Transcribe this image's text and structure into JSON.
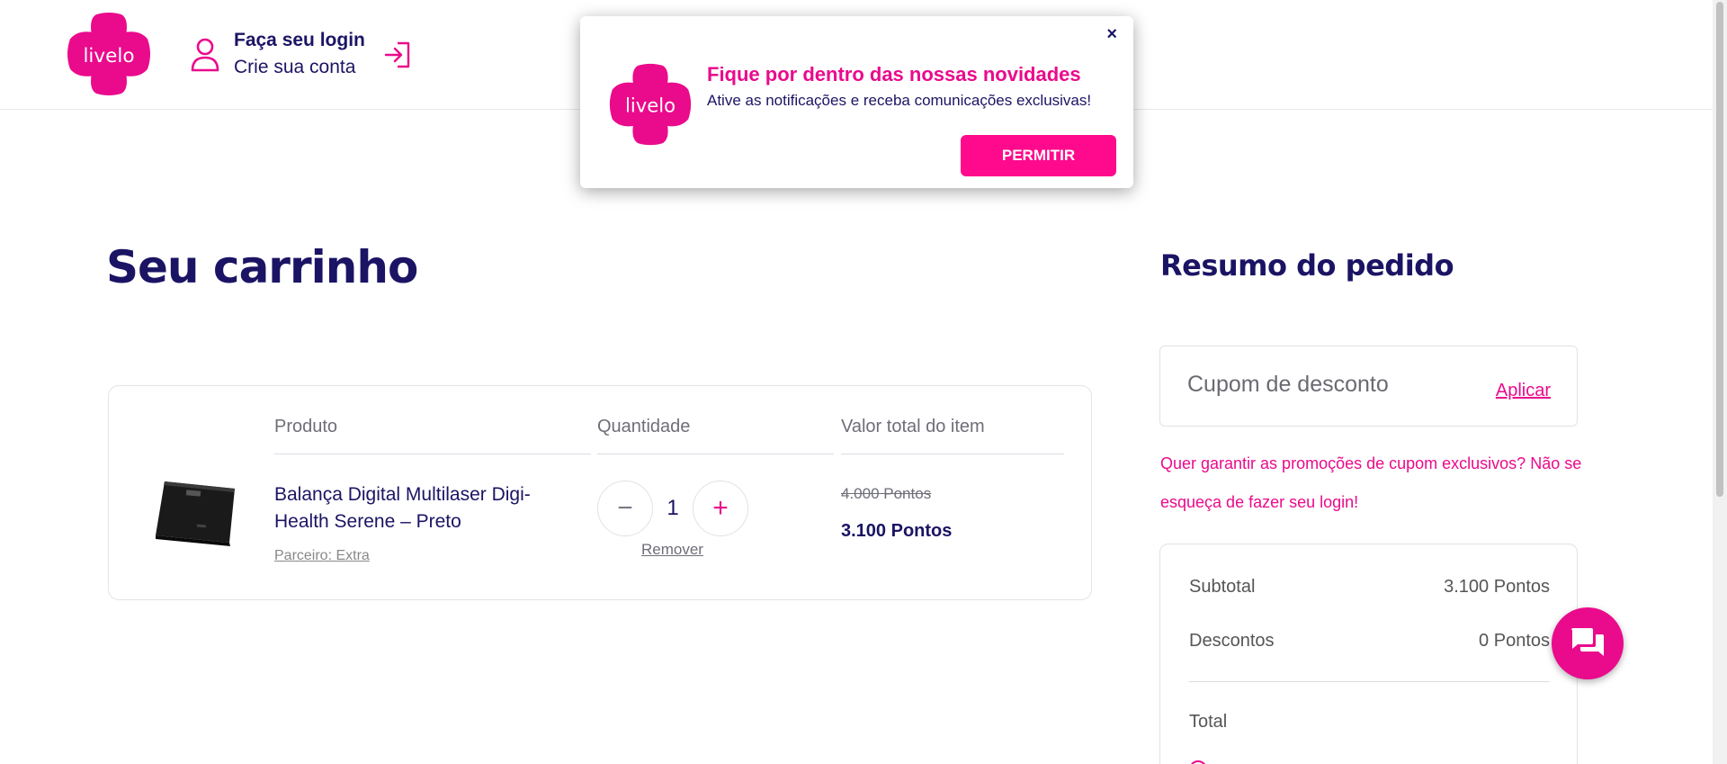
{
  "brand": {
    "logo_text": "livelo",
    "primary_color": "#ea0a8c",
    "navy_color": "#1b1464"
  },
  "header": {
    "login_title": "Faça seu login",
    "login_subtitle": "Crie sua conta"
  },
  "notification_popup": {
    "close_label": "×",
    "title": "Fique por dentro das nossas novidades",
    "text": "Ative as notificações e receba comunicações exclusivas!",
    "button_label": "PERMITIR"
  },
  "cart": {
    "title": "Seu carrinho",
    "columns": {
      "product": "Produto",
      "quantity": "Quantidade",
      "value": "Valor total do item"
    },
    "items": [
      {
        "name": "Balança Digital Multilaser Digi-Health Serene – Preto",
        "partner": "Parceiro: Extra",
        "quantity": "1",
        "minus_label": "−",
        "plus_label": "+",
        "remove_label": "Remover",
        "old_price": "4.000 Pontos",
        "price": "3.100 Pontos"
      }
    ]
  },
  "summary": {
    "title": "Resumo do pedido",
    "coupon_placeholder": "Cupom de desconto",
    "coupon_apply": "Aplicar",
    "promo_message": "Quer garantir as promoções de cupom exclusivos? Não se esqueça de fazer seu login!",
    "subtotal_label": "Subtotal",
    "subtotal_value": "3.100 Pontos",
    "discounts_label": "Descontos",
    "discounts_value": "0 Pontos",
    "total_label": "Total"
  },
  "icons": {
    "user": "user-icon",
    "login_arrow": "login-arrow-icon",
    "chat": "chat-icon",
    "close": "close-icon"
  }
}
